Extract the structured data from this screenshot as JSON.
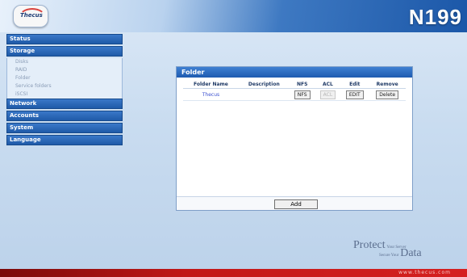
{
  "header": {
    "logo_text": "Thecus",
    "model": "N199"
  },
  "sidebar": {
    "menus": [
      {
        "label": "Status"
      },
      {
        "label": "Storage",
        "items": [
          "Disks",
          "RAID",
          "Folder",
          "Service folders",
          "iSCSI"
        ]
      },
      {
        "label": "Network"
      },
      {
        "label": "Accounts"
      },
      {
        "label": "System"
      },
      {
        "label": "Language"
      }
    ]
  },
  "panel": {
    "title": "Folder",
    "columns": [
      "Folder Name",
      "Description",
      "NFS",
      "ACL",
      "Edit",
      "Remove"
    ],
    "rows": [
      {
        "folder_name": "Thecus",
        "description": "",
        "nfs": "NFS",
        "acl": "ACL",
        "edit": "EDIT",
        "remove": "Delete"
      }
    ],
    "add_label": "Add"
  },
  "branding": {
    "protect": "Protect",
    "your_server": "Your Server",
    "secure": "Secure Your",
    "data": "Data",
    "url": "www.thecus.com"
  },
  "colors": {
    "accent": "#1f5aa8",
    "bottom_bar": "#c21717"
  }
}
